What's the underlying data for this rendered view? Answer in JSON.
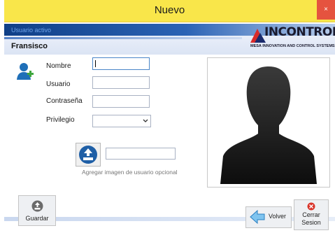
{
  "window": {
    "title": "Nuevo",
    "close_glyph": "×"
  },
  "header": {
    "active_user_label": "Usuario activo",
    "user_name": "Fransisco",
    "logo": {
      "brand": "INCONTROL",
      "tagline": "MESA INNOVATION AND CONTROL SYSTEMS",
      "accent": "#d92a2a",
      "dark": "#1a2a6c"
    }
  },
  "form": {
    "name_label": "Nombre",
    "name_value": "",
    "user_label": "Usuario",
    "user_value": "",
    "password_label": "Contraseña",
    "password_value": "",
    "privilege_label": "Privilegio",
    "privilege_value": ""
  },
  "upload": {
    "path_value": "",
    "caption": "Agregar imagen de usuario opcional"
  },
  "buttons": {
    "save": "Guardar",
    "back": "Volver",
    "logout_line1": "Cerrar",
    "logout_line2": "Sesion"
  },
  "icons": {
    "user_add": "user-add-icon",
    "upload": "upload-icon",
    "save": "save-icon",
    "back": "back-arrow-icon",
    "logout": "logout-icon",
    "photo": "user-silhouette-icon"
  },
  "colors": {
    "titlebar": "#f9e64a",
    "header_dark": "#0f3f87",
    "close": "#e5533f"
  }
}
